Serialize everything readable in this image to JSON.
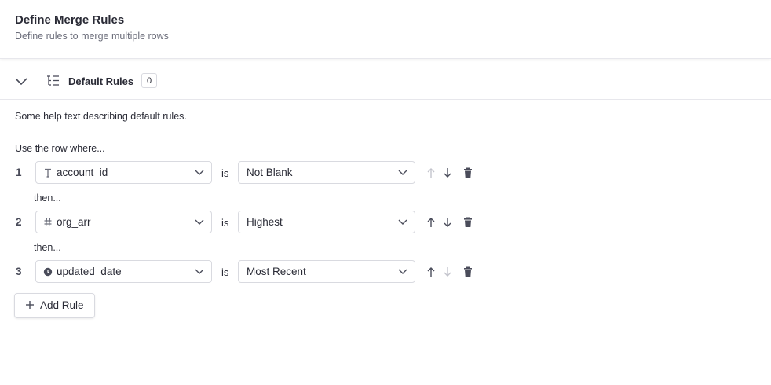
{
  "header": {
    "title": "Define Merge Rules",
    "subtitle": "Define rules to merge multiple rows"
  },
  "section": {
    "title": "Default Rules",
    "count": "0",
    "help": "Some help text describing default rules.",
    "intro": "Use the row where..."
  },
  "rules": [
    {
      "index": "1",
      "field": "account_id",
      "type_icon": "text-type-icon",
      "operator": "is",
      "condition": "Not Blank",
      "move_up_enabled": false,
      "move_down_enabled": true
    },
    {
      "index": "2",
      "field": "org_arr",
      "type_icon": "number-type-icon",
      "operator": "is",
      "condition": "Highest",
      "move_up_enabled": true,
      "move_down_enabled": true
    },
    {
      "index": "3",
      "field": "updated_date",
      "type_icon": "date-type-icon",
      "operator": "is",
      "condition": "Most Recent",
      "move_up_enabled": true,
      "move_down_enabled": false
    }
  ],
  "connector": "then...",
  "add_rule_label": "Add Rule",
  "colors": {
    "text": "#2a2b36",
    "muted": "#6b6d7a",
    "border": "#d9dae0",
    "icon_active": "#4a4c5a",
    "icon_disabled": "#c3c4cc"
  }
}
